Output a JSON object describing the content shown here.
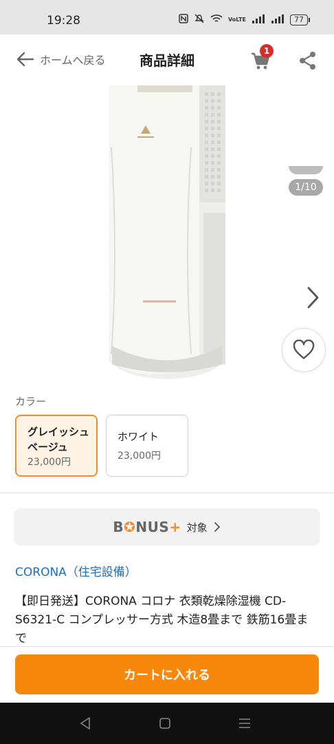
{
  "status": {
    "time": "19:28",
    "network": "VoLTE",
    "battery": "77"
  },
  "header": {
    "back_label": "ホームへ戻る",
    "title": "商品詳細",
    "cart_count": "1"
  },
  "gallery": {
    "counter": "1/10"
  },
  "colors": {
    "label": "カラー",
    "options": [
      {
        "name": "グレイッシュベージュ",
        "price": "23,000円",
        "selected": true
      },
      {
        "name": "ホワイト",
        "price": "23,000円",
        "selected": false
      }
    ]
  },
  "bonus": {
    "logo_a": "B",
    "logo_b": "NUS",
    "logo_plus": "+",
    "text": "対象"
  },
  "product": {
    "brand": "CORONA（住宅設備）",
    "title": "【即日発送】CORONA コロナ 衣類乾燥除湿機 CD-S6321-C コンプレッサー方式 木造8畳まで 鉄筋16畳まで"
  },
  "cta": {
    "add_to_cart": "カートに入れる"
  },
  "theme": {
    "accent": "#f7880b",
    "link": "#1a6fc4",
    "badge": "#d0312d"
  }
}
